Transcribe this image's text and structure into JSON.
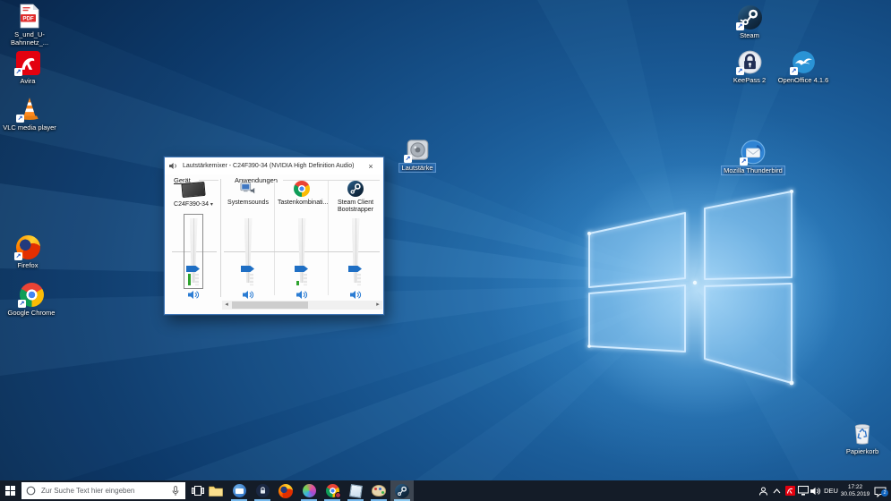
{
  "wallpaper": {
    "base_color": "#0d3a6b",
    "beam_color": "#7dc3f5",
    "description": "windows-10-hero-window-logo"
  },
  "desktop_icons": {
    "pdf": {
      "label": "S_und_U-Bahnnetz_...",
      "badge": "PDF",
      "icon": "pdf-file-icon"
    },
    "avira": {
      "label": "Avira",
      "icon": "avira-icon"
    },
    "vlc": {
      "label": "VLC media player",
      "icon": "vlc-cone-icon"
    },
    "firefox": {
      "label": "Firefox",
      "icon": "firefox-icon"
    },
    "chrome": {
      "label": "Google Chrome",
      "icon": "chrome-icon"
    },
    "lautstaerke": {
      "label": "Lautstärke",
      "icon": "speaker-icon",
      "selected": true
    },
    "steam": {
      "label": "Steam",
      "icon": "steam-icon"
    },
    "keepass": {
      "label": "KeePass 2",
      "icon": "keepass-lock-icon"
    },
    "openoffice": {
      "label": "OpenOffice 4.1.6",
      "icon": "openoffice-gull-icon"
    },
    "thunderbird": {
      "label": "Mozilla Thunderbird",
      "icon": "thunderbird-icon",
      "selected": true
    },
    "papierkorb": {
      "label": "Papierkorb",
      "icon": "recycle-bin-icon"
    }
  },
  "mixer": {
    "title": "Lautstärkemixer - C24F390-34 (NVIDIA High Definition Audio)",
    "close_glyph": "×",
    "sections": {
      "device": "Gerät",
      "apps": "Anwendungen"
    },
    "device": {
      "name": "C24F390-34",
      "dropdown_glyph": "▾",
      "volume_percent": 25,
      "muted": false
    },
    "apps": [
      {
        "name": "Systemsounds",
        "icon": "system-sounds-icon",
        "volume_percent": 25
      },
      {
        "name": "Tastenkombinati...",
        "icon": "chrome-icon",
        "volume_percent": 25
      },
      {
        "name": "Steam Client Bootstrapper",
        "icon": "steam-icon",
        "volume_percent": 25
      }
    ],
    "scrollbar": {
      "left_glyph": "◂",
      "right_glyph": "▸"
    }
  },
  "taskbar": {
    "search": {
      "placeholder": "Zur Suche Text hier eingeben"
    },
    "buttons": [
      {
        "name": "start"
      },
      {
        "name": "task-view"
      },
      {
        "name": "file-explorer"
      },
      {
        "name": "thunderbird",
        "running": true
      },
      {
        "name": "keepass",
        "running": true
      },
      {
        "name": "firefox",
        "running": false
      },
      {
        "name": "pink-app",
        "running": true
      },
      {
        "name": "chrome",
        "running": true
      },
      {
        "name": "notes-app",
        "running": true
      },
      {
        "name": "paint-app",
        "running": true
      },
      {
        "name": "steam",
        "running": true,
        "active": true
      }
    ],
    "tray": {
      "language": "DEU",
      "time": "17:22",
      "date": "30.05.2019",
      "notification_count": "2"
    }
  }
}
